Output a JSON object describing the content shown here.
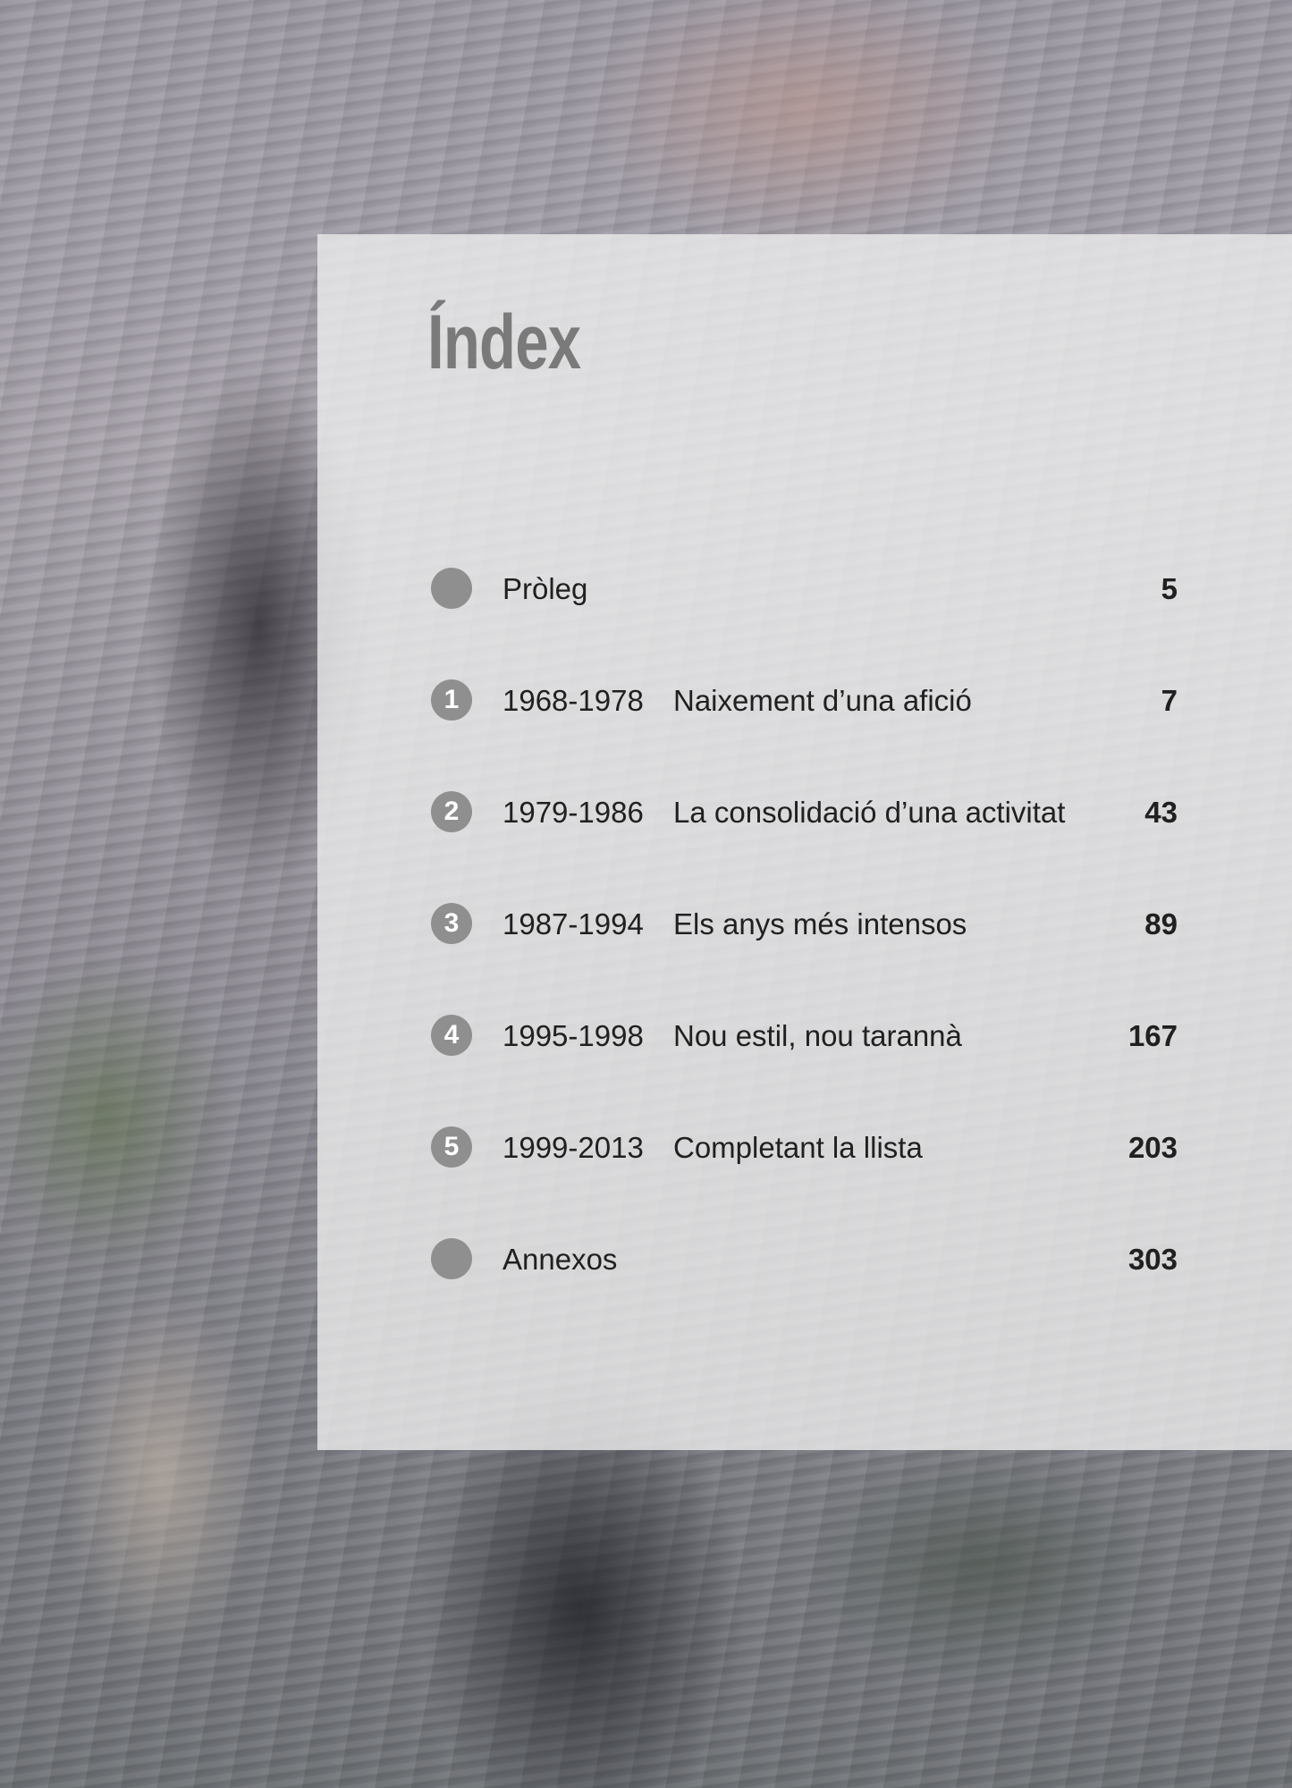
{
  "title": "Índex",
  "entries": [
    {
      "number": "",
      "period": "",
      "title": "Pròleg",
      "page": "5"
    },
    {
      "number": "1",
      "period": "1968-1978",
      "title": "Naixement d’una afició",
      "page": "7"
    },
    {
      "number": "2",
      "period": "1979-1986",
      "title": "La consolidació d’una activitat",
      "page": "43"
    },
    {
      "number": "3",
      "period": "1987-1994",
      "title": "Els anys més intensos",
      "page": "89"
    },
    {
      "number": "4",
      "period": "1995-1998",
      "title": "Nou estil, nou tarannà",
      "page": "167"
    },
    {
      "number": "5",
      "period": "1999-2013",
      "title": "Completant la llista",
      "page": "203"
    },
    {
      "number": "",
      "period": "",
      "title": "Annexos",
      "page": "303"
    }
  ],
  "colors": {
    "panel": "#ececec",
    "bullet": "#8f8f8f",
    "title": "#7a7a7a",
    "text": "#202020"
  }
}
